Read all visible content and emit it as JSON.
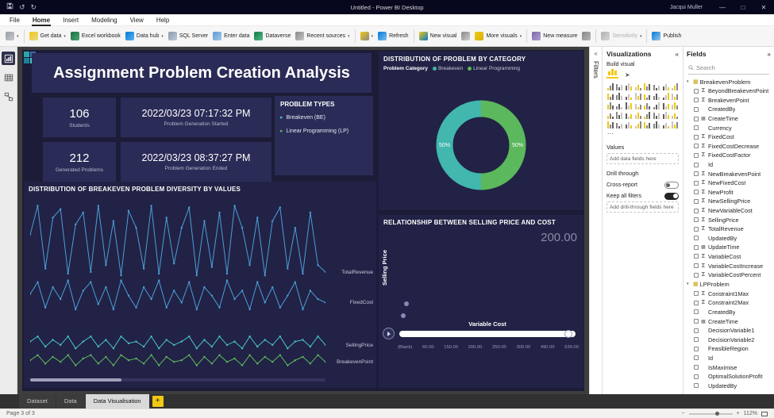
{
  "window": {
    "title": "Untitled - Power BI Desktop",
    "user": "Jacqui Muller",
    "controls": {
      "minimize": "—",
      "maximize": "□",
      "close": "✕"
    }
  },
  "menu": {
    "items": [
      {
        "label": "File"
      },
      {
        "label": "Home",
        "active": true
      },
      {
        "label": "Insert"
      },
      {
        "label": "Modeling"
      },
      {
        "label": "View"
      },
      {
        "label": "Help"
      }
    ]
  },
  "ribbon": {
    "items": [
      {
        "name": "paste",
        "label": "",
        "icon": "clipboard",
        "caret": true
      },
      {
        "sep": true
      },
      {
        "name": "get-data",
        "label": "Get data",
        "icon": "database",
        "caret": true
      },
      {
        "name": "excel-workbook",
        "label": "Excel workbook",
        "icon": "excel"
      },
      {
        "name": "data-hub",
        "label": "Data hub",
        "icon": "hub",
        "caret": true
      },
      {
        "name": "sql-server",
        "label": "SQL Server",
        "icon": "server"
      },
      {
        "name": "enter-data",
        "label": "Enter data",
        "icon": "table"
      },
      {
        "name": "dataverse",
        "label": "Dataverse",
        "icon": "dataverse"
      },
      {
        "name": "recent-sources",
        "label": "Recent sources",
        "icon": "clock",
        "caret": true
      },
      {
        "sep": true
      },
      {
        "name": "transform-data",
        "label": "",
        "icon": "transform",
        "caret": true
      },
      {
        "name": "refresh",
        "label": "Refresh",
        "icon": "refresh"
      },
      {
        "sep": true
      },
      {
        "name": "new-visual",
        "label": "New visual",
        "icon": "chart"
      },
      {
        "name": "text-box",
        "label": "",
        "icon": "textbox"
      },
      {
        "name": "more-visuals",
        "label": "More visuals",
        "icon": "more",
        "caret": true
      },
      {
        "sep": true
      },
      {
        "name": "new-measure",
        "label": "New measure",
        "icon": "measure"
      },
      {
        "name": "quick-measure",
        "label": "",
        "icon": "calc"
      },
      {
        "sep": true
      },
      {
        "name": "sensitivity",
        "label": "Sensitivity",
        "icon": "shield",
        "caret": true,
        "disabled": true
      },
      {
        "sep": true
      },
      {
        "name": "publish",
        "label": "Publish",
        "icon": "publish"
      }
    ]
  },
  "report": {
    "title": "Assignment Problem Creation Analysis",
    "cards": [
      {
        "value": "106",
        "label": "Students"
      },
      {
        "value": "2022/03/23 07:17:32 PM",
        "label": "Problem Generation Started"
      },
      {
        "value": "212",
        "label": "Generated Problems"
      },
      {
        "value": "2022/03/23 08:37:27 PM",
        "label": "Problem Generation Ended"
      }
    ],
    "problem_types": {
      "title": "PROBLEM TYPES",
      "items": [
        {
          "label": "Breakeven (BE)",
          "color": "#45c5c0"
        },
        {
          "label": "Linear Programming (LP)",
          "color": "#5cb85c"
        }
      ]
    }
  },
  "chart_data": [
    {
      "type": "donut",
      "title": "DISTRIBUTION OF PROBLEM BY CATEGORY",
      "legend_title": "Problem Category",
      "legend_position": "top",
      "slices": [
        {
          "name": "Breakeven",
          "value": 50,
          "label": "50%",
          "color": "#41b7ae"
        },
        {
          "name": "Linear Programming",
          "value": 50,
          "label": "50%",
          "color": "#5cb85c"
        }
      ]
    },
    {
      "type": "line",
      "title": "DISTRIBUTION OF BREAKEVEN PROBLEM DIVERSITY BY VALUES",
      "grid": "off",
      "series": [
        {
          "name": "TotalRevenue",
          "color": "#4a9fd8",
          "values": [
            0.8,
            0.97,
            0.6,
            0.9,
            0.95,
            0.57,
            0.86,
            0.93,
            0.58,
            0.97,
            0.62,
            0.88,
            0.56,
            0.94,
            0.84,
            0.6,
            0.97,
            0.57,
            0.9,
            0.63,
            0.84,
            0.96,
            0.56,
            0.88,
            0.61,
            0.93,
            0.57,
            0.97,
            0.84,
            0.62,
            0.9,
            0.56,
            0.88,
            0.96,
            0.6,
            0.84,
            0.57,
            0.93,
            0.62,
            0.58
          ]
        },
        {
          "name": "FixedCost",
          "color": "#4a9fd8",
          "values": [
            0.45,
            0.52,
            0.37,
            0.49,
            0.42,
            0.53,
            0.36,
            0.47,
            0.52,
            0.39,
            0.49,
            0.36,
            0.53,
            0.44,
            0.37,
            0.49,
            0.42,
            0.53,
            0.37,
            0.47,
            0.4,
            0.52,
            0.36,
            0.49,
            0.44,
            0.37,
            0.53,
            0.42,
            0.47,
            0.36,
            0.52,
            0.4,
            0.49,
            0.37,
            0.44,
            0.52,
            0.36,
            0.47,
            0.42,
            0.4
          ]
        },
        {
          "name": "SellingPrice",
          "color": "#45c5c0",
          "values": [
            0.17,
            0.2,
            0.14,
            0.18,
            0.15,
            0.2,
            0.13,
            0.17,
            0.2,
            0.14,
            0.18,
            0.13,
            0.2,
            0.16,
            0.17,
            0.14,
            0.2,
            0.13,
            0.18,
            0.15,
            0.17,
            0.2,
            0.13,
            0.18,
            0.14,
            0.2,
            0.15,
            0.17,
            0.13,
            0.2,
            0.14,
            0.18,
            0.15,
            0.2,
            0.13,
            0.17,
            0.18,
            0.14,
            0.2,
            0.15
          ]
        },
        {
          "name": "BreakevenPoint",
          "color": "#5cb85c",
          "values": [
            0.06,
            0.09,
            0.04,
            0.08,
            0.05,
            0.09,
            0.03,
            0.07,
            0.09,
            0.04,
            0.08,
            0.03,
            0.09,
            0.06,
            0.07,
            0.04,
            0.09,
            0.03,
            0.08,
            0.05,
            0.06,
            0.09,
            0.03,
            0.08,
            0.04,
            0.09,
            0.05,
            0.07,
            0.03,
            0.09,
            0.04,
            0.08,
            0.05,
            0.09,
            0.03,
            0.06,
            0.08,
            0.04,
            0.09,
            0.05
          ]
        }
      ]
    },
    {
      "type": "scatter",
      "title": "RELATIONSHIP BETWEEN SELLING PRICE AND COST",
      "ylabel": "Selling Price",
      "value_display": "200.00",
      "point_color": "#b3a7e0",
      "points": [
        {
          "x": 0.07,
          "y": 0.8
        },
        {
          "x": 0.05,
          "y": 0.93
        }
      ],
      "slider": {
        "label": "Variable Cost",
        "ticks": [
          "(Blank)",
          "60.00",
          "150.00",
          "200.00",
          "250.00",
          "300.00",
          "490.00",
          "630.00"
        ]
      }
    }
  ],
  "filters_panel": {
    "title": "Filters",
    "collapse_icon": "«"
  },
  "viz_panel": {
    "title": "Visualizations",
    "collapse_icon": "«",
    "build_label": "Build visual",
    "values_label": "Values",
    "values_placeholder": "Add data fields here",
    "drill_label": "Drill through",
    "cross_report_label": "Cross-report",
    "cross_report_state": "Off",
    "keep_filters_label": "Keep all filters",
    "keep_filters_state": "On",
    "drill_placeholder": "Add drill-through fields here",
    "icons": [
      "stacked-bar-chart",
      "stacked-column-chart",
      "clustered-bar-chart",
      "clustered-column-chart",
      "hundred-stacked-bar-chart",
      "hundred-stacked-column-chart",
      "line-chart",
      "area-chart",
      "stacked-area-chart",
      "line-and-stacked-column-chart",
      "line-and-clustered-column-chart",
      "ribbon-chart",
      "waterfall-chart",
      "funnel-chart",
      "scatter-chart",
      "pie-chart",
      "donut-chart",
      "treemap",
      "map",
      "filled-map",
      "shape-map",
      "azure-map",
      "gauge",
      "card",
      "multi-row-card",
      "kpi",
      "slicer",
      "table",
      "matrix",
      "r-script-visual",
      "python-visual",
      "key-influencers",
      "decomposition-tree",
      "q-and-a",
      "smart-narrative",
      "paginated-report",
      "arcgis-map",
      "power-apps",
      "power-automate",
      "metrics",
      "more-options"
    ]
  },
  "fields_panel": {
    "title": "Fields",
    "collapse_icon": "»",
    "search_placeholder": "Search",
    "tables": [
      {
        "name": "BreakevenProblem",
        "fields": [
          {
            "name": "BeyondBreakevenPoint",
            "icon": "sigma"
          },
          {
            "name": "BreakevenPoint",
            "icon": "sigma"
          },
          {
            "name": "CreatedBy"
          },
          {
            "name": "CreateTime",
            "icon": "calendar"
          },
          {
            "name": "Currency"
          },
          {
            "name": "FixedCost",
            "icon": "sigma"
          },
          {
            "name": "FixedCostDecrease",
            "icon": "sigma"
          },
          {
            "name": "FixedCostFactor",
            "icon": "sigma"
          },
          {
            "name": "Id"
          },
          {
            "name": "NewBreakevenPoint",
            "icon": "sigma"
          },
          {
            "name": "NewFixedCost",
            "icon": "sigma"
          },
          {
            "name": "NewProfit",
            "icon": "sigma"
          },
          {
            "name": "NewSellingPrice",
            "icon": "sigma"
          },
          {
            "name": "NewVariableCost",
            "icon": "sigma"
          },
          {
            "name": "SellingPrice",
            "icon": "sigma"
          },
          {
            "name": "TotalRevenue",
            "icon": "sigma"
          },
          {
            "name": "UpdatedBy"
          },
          {
            "name": "UpdateTime",
            "icon": "calendar"
          },
          {
            "name": "VariableCost",
            "icon": "sigma"
          },
          {
            "name": "VariableCostIncrease",
            "icon": "sigma"
          },
          {
            "name": "VariableCostPercent",
            "icon": "sigma"
          }
        ]
      },
      {
        "name": "LPProblem",
        "fields": [
          {
            "name": "Constraint1Max",
            "icon": "sigma"
          },
          {
            "name": "Constraint2Max",
            "icon": "sigma"
          },
          {
            "name": "CreatedBy"
          },
          {
            "name": "CreateTime",
            "icon": "calendar"
          },
          {
            "name": "DecisionVariable1"
          },
          {
            "name": "DecisionVariable2"
          },
          {
            "name": "FeasibleRegion"
          },
          {
            "name": "Id"
          },
          {
            "name": "IsMaximise"
          },
          {
            "name": "OptimalSolutionProfit"
          },
          {
            "name": "UpdatedBy"
          }
        ]
      }
    ]
  },
  "tabs": {
    "items": [
      {
        "label": "Dataset"
      },
      {
        "label": "Data"
      },
      {
        "label": "Data Visualisation",
        "active": true
      }
    ],
    "add_label": "+"
  },
  "status": {
    "page": "Page 3 of 3",
    "zoom": "112%"
  },
  "colors": {
    "accent": "#f2c811",
    "teal": "#41b7ae",
    "green": "#5cb85c",
    "blue": "#4a9fd8",
    "page_bg": "#1c1c38",
    "visual_bg": "#222246",
    "card_bg": "#2b2b57"
  }
}
